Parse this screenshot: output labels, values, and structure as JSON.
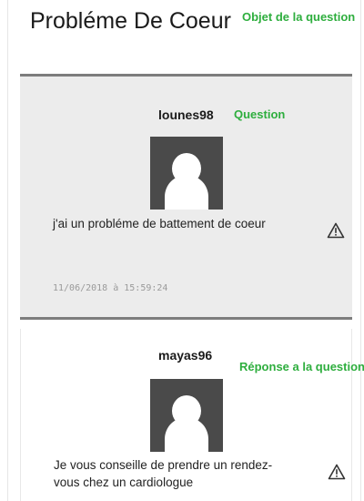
{
  "page": {
    "title": "Probléme De Coeur"
  },
  "annotations": {
    "subject": "Objet de la question",
    "question": "Question",
    "answer": "Réponse a la question"
  },
  "question": {
    "username": "lounes98",
    "text": "j'ai un probléme de battement de coeur",
    "timestamp": "11/06/2018 à 15:59:24",
    "avatar_icon": "user-silhouette-icon",
    "report_icon": "warning-triangle-icon"
  },
  "answer": {
    "username": "mayas96",
    "text": "Je vous conseille de prendre un rendez-vous chez un cardiologue",
    "avatar_icon": "user-silhouette-icon",
    "report_icon": "warning-triangle-icon"
  },
  "colors": {
    "annotation_green": "#2eae3e",
    "card_background": "#ececec",
    "card_border": "#7d7d7d",
    "avatar_background": "#4a4a4a"
  }
}
